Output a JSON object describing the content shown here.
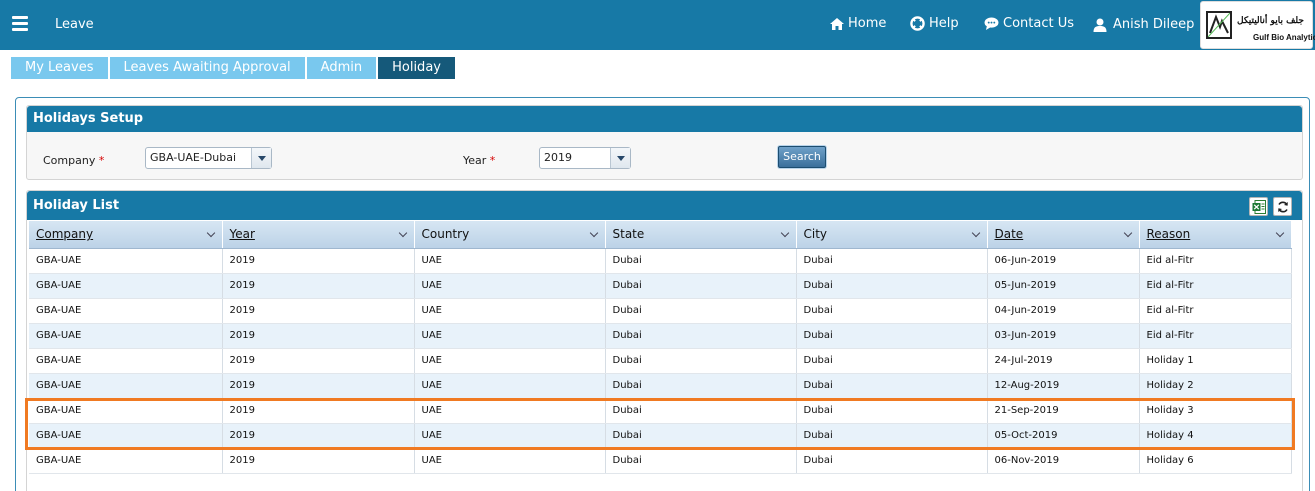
{
  "header": {
    "app_title": "Leave",
    "nav": [
      {
        "label": "Home",
        "icon": "home-icon"
      },
      {
        "label": "Help",
        "icon": "lifebuoy-icon"
      },
      {
        "label": "Contact Us",
        "icon": "chat-icon"
      },
      {
        "label": "Anish Dileep",
        "icon": "user-icon"
      }
    ],
    "logo": {
      "arabic": "جلف بايو أناليتيكل",
      "english": "Gulf Bio Analytical"
    }
  },
  "tabs": [
    {
      "label": "My Leaves",
      "active": false
    },
    {
      "label": "Leaves Awaiting Approval",
      "active": false
    },
    {
      "label": "Admin",
      "active": false
    },
    {
      "label": "Holiday",
      "active": true
    }
  ],
  "setup": {
    "title": "Holidays Setup",
    "company_label": "Company",
    "company_value": "GBA-UAE-Dubai",
    "year_label": "Year",
    "year_value": "2019",
    "required_mark": "*",
    "search_label": "Search"
  },
  "list": {
    "title": "Holiday List",
    "columns": [
      "Company",
      "Year",
      "Country",
      "State",
      "City",
      "Date",
      "Reason"
    ],
    "rows": [
      [
        "GBA-UAE",
        "2019",
        "UAE",
        "Dubai",
        "Dubai",
        "06-Jun-2019",
        "Eid al-Fitr"
      ],
      [
        "GBA-UAE",
        "2019",
        "UAE",
        "Dubai",
        "Dubai",
        "05-Jun-2019",
        "Eid al-Fitr"
      ],
      [
        "GBA-UAE",
        "2019",
        "UAE",
        "Dubai",
        "Dubai",
        "04-Jun-2019",
        "Eid al-Fitr"
      ],
      [
        "GBA-UAE",
        "2019",
        "UAE",
        "Dubai",
        "Dubai",
        "03-Jun-2019",
        "Eid al-Fitr"
      ],
      [
        "GBA-UAE",
        "2019",
        "UAE",
        "Dubai",
        "Dubai",
        "24-Jul-2019",
        "Holiday 1"
      ],
      [
        "GBA-UAE",
        "2019",
        "UAE",
        "Dubai",
        "Dubai",
        "12-Aug-2019",
        "Holiday 2"
      ],
      [
        "GBA-UAE",
        "2019",
        "UAE",
        "Dubai",
        "Dubai",
        "21-Sep-2019",
        "Holiday 3"
      ],
      [
        "GBA-UAE",
        "2019",
        "UAE",
        "Dubai",
        "Dubai",
        "05-Oct-2019",
        "Holiday 4"
      ],
      [
        "GBA-UAE",
        "2019",
        "UAE",
        "Dubai",
        "Dubai",
        "06-Nov-2019",
        "Holiday 6"
      ]
    ],
    "tools": [
      {
        "icon": "excel-export-icon"
      },
      {
        "icon": "refresh-icon"
      }
    ]
  },
  "colors": {
    "header_bg": "#1779a6",
    "tab_bg": "#79c8ee",
    "tab_active_bg": "#15597a",
    "highlight": "#f07a22"
  }
}
